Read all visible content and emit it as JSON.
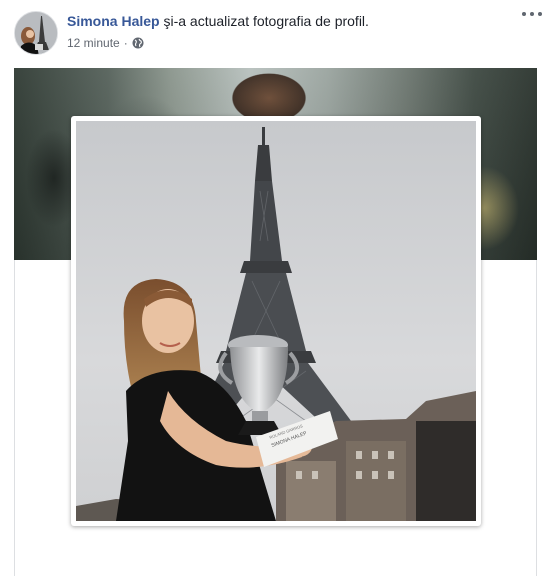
{
  "post": {
    "author": "Simona Halep",
    "action_text": "şi-a actualizat fotografia de profil.",
    "timestamp": "12 minute",
    "separator": "·",
    "privacy_icon": "globe-icon",
    "more_icon": "more-options-icon"
  },
  "photo": {
    "trophy_plate_text": "SIMONA HALEP",
    "trophy_plate_text2": "ROLAND GARROS"
  }
}
